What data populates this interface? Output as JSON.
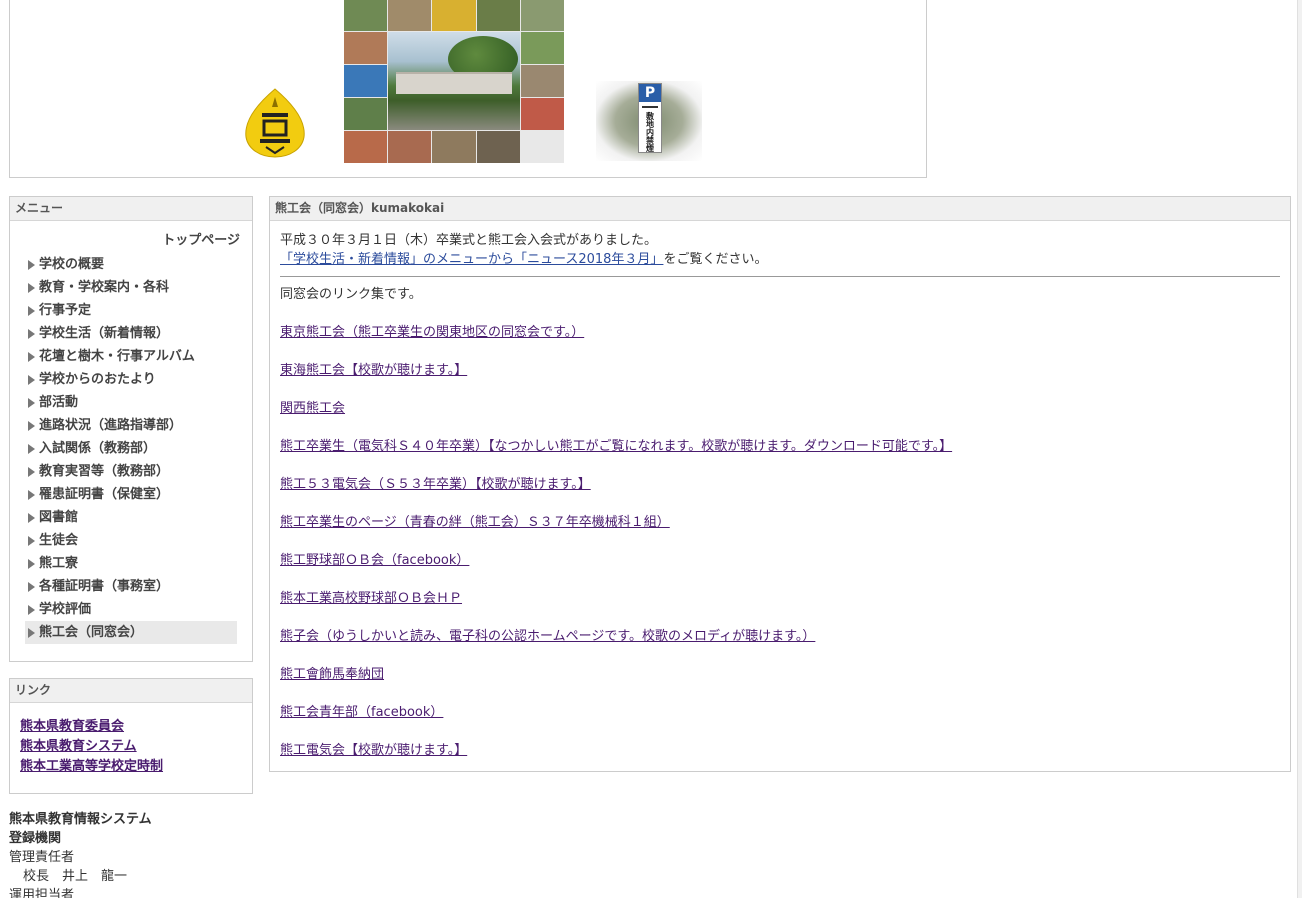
{
  "menu": {
    "title": "メニュー",
    "top_link": "トップページ",
    "items": [
      {
        "label": "学校の概要"
      },
      {
        "label": "教育・学校案内・各科"
      },
      {
        "label": "行事予定"
      },
      {
        "label": "学校生活（新着情報）"
      },
      {
        "label": "花壇と樹木・行事アルバム"
      },
      {
        "label": "学校からのおたより"
      },
      {
        "label": "部活動"
      },
      {
        "label": "進路状況（進路指導部）"
      },
      {
        "label": "入試関係（教務部）"
      },
      {
        "label": "教育実習等（教務部）"
      },
      {
        "label": "罹患証明書（保健室）"
      },
      {
        "label": "図書館"
      },
      {
        "label": "生徒会"
      },
      {
        "label": "熊工寮"
      },
      {
        "label": "各種証明書（事務室）"
      },
      {
        "label": "学校評価"
      },
      {
        "label": "熊工会（同窓会）",
        "active": true
      }
    ]
  },
  "links": {
    "title": "リンク",
    "items": [
      {
        "label": "熊本県教育委員会"
      },
      {
        "label": "熊本県教育システム"
      },
      {
        "label": "熊本工業高等学校定時制"
      }
    ]
  },
  "footer": {
    "system_name": "熊本県教育情報システム",
    "registered_org": "登録機関",
    "admin_label": "管理責任者",
    "admin_name": "校長　井上　龍一",
    "operator_label": "運用担当者"
  },
  "main": {
    "title": "熊工会（同窓会）kumakokai",
    "notice_line1": "平成３０年３月１日（木）卒業式と熊工会入会式がありました。",
    "notice_link1": "「学校生活・新着情報」のメニューから「ニュース2018年３月」",
    "notice_suffix": "をご覧ください。",
    "lead": "同窓会のリンク集です。",
    "alumni_links": [
      {
        "label": "東京熊工会（熊工卒業生の関東地区の同窓会です。）"
      },
      {
        "label": "東海熊工会【校歌が聴けます。】"
      },
      {
        "label": "関西熊工会"
      },
      {
        "label": "熊工卒業生（電気科Ｓ４０年卒業）【なつかしい熊工がご覧になれます。校歌が聴けます。ダウンロード可能です。】"
      },
      {
        "label": "熊工５３電気会（Ｓ５３年卒業）【校歌が聴けます。】"
      },
      {
        "label": "熊工卒業生のページ（青春の絆（熊工会）Ｓ３７年卒機械科１組）"
      },
      {
        "label": "熊工野球部ＯＢ会（facebook）"
      },
      {
        "label": "熊本工業高校野球部ＯＢ会ＨＰ"
      },
      {
        "label": "熊子会（ゆうしかいと読み、電子科の公認ホームページです。校歌のメロディが聴けます。）"
      },
      {
        "label": "熊工會飾馬奉納団"
      },
      {
        "label": "熊工会青年部（facebook）"
      },
      {
        "label": "熊工電気会【校歌が聴けます。】"
      }
    ]
  },
  "colors": {
    "panel_border": "#cccccc",
    "panel_header_bg": "#f0f0f0",
    "visited_link": "#4a1c6f",
    "link": "#2c4c9c",
    "active_menu_bg": "#e9e9e9"
  }
}
